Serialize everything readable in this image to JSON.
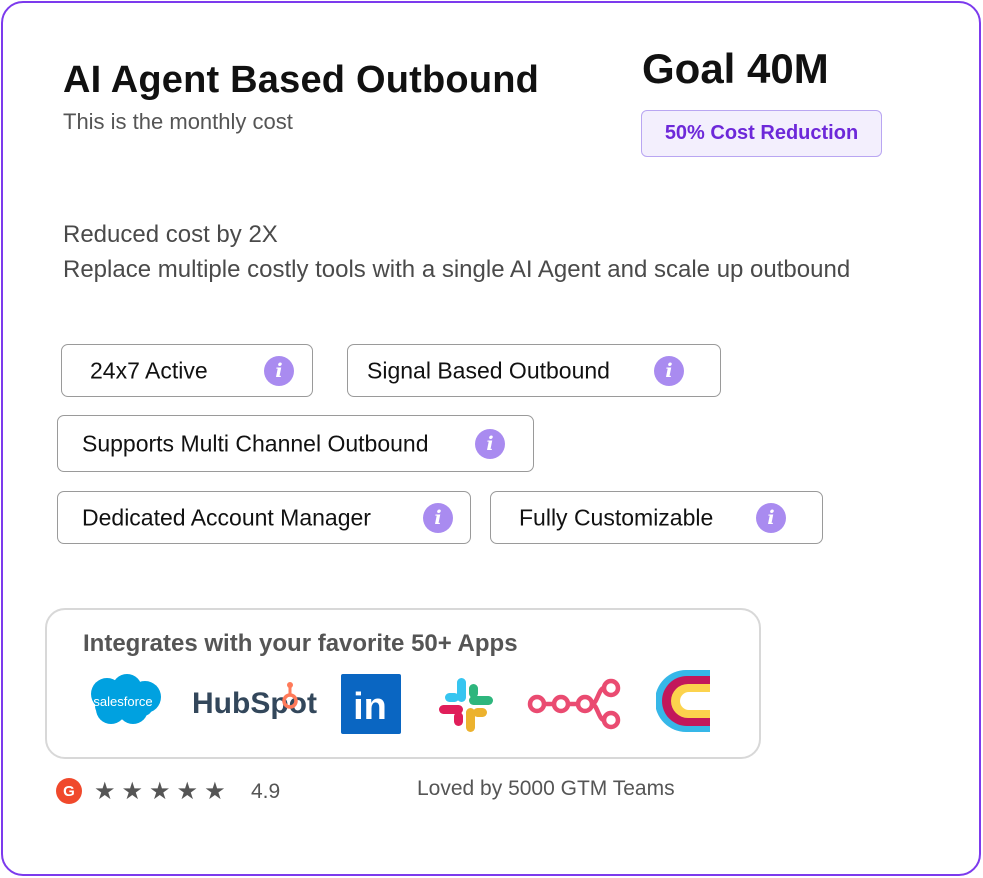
{
  "header": {
    "title": "AI Agent Based Outbound",
    "subtitle": "This is the monthly cost",
    "goal": "Goal 40M",
    "badge": "50% Cost Reduction"
  },
  "description": {
    "line1": "Reduced cost by 2X",
    "line2": "Replace multiple costly tools with a single AI Agent and scale up outbound"
  },
  "features": [
    {
      "label": "24x7 Active",
      "icon": "info-icon"
    },
    {
      "label": "Signal Based Outbound",
      "icon": "info-icon"
    },
    {
      "label": "Supports Multi Channel Outbound",
      "icon": "info-icon"
    },
    {
      "label": "Dedicated Account Manager",
      "icon": "info-icon"
    },
    {
      "label": "Fully Customizable",
      "icon": "info-icon"
    }
  ],
  "info_glyph": "i",
  "integrations": {
    "title": "Integrates with your favorite 50+ Apps",
    "apps": [
      {
        "name": "salesforce",
        "label": "salesforce"
      },
      {
        "name": "hubspot",
        "label": "HubSpot"
      },
      {
        "name": "linkedin",
        "label": "in"
      },
      {
        "name": "slack",
        "label": ""
      },
      {
        "name": "n8n",
        "label": ""
      },
      {
        "name": "clay",
        "label": ""
      }
    ]
  },
  "rating": {
    "g2_label": "G",
    "stars": "★★★★★",
    "star_count": 5,
    "score": "4.9"
  },
  "social_proof": "Loved by 5000 GTM Teams",
  "colors": {
    "accent": "#7c3aed",
    "badge_text": "#6d28d9",
    "badge_bg": "#f3effd",
    "info_icon": "#a98bf0",
    "g2": "#f0492c",
    "salesforce": "#00a1e0",
    "hubspot_text": "#33475b",
    "hubspot_orange": "#ff7a59",
    "linkedin": "#0a66c2",
    "n8n": "#ea4b71"
  }
}
